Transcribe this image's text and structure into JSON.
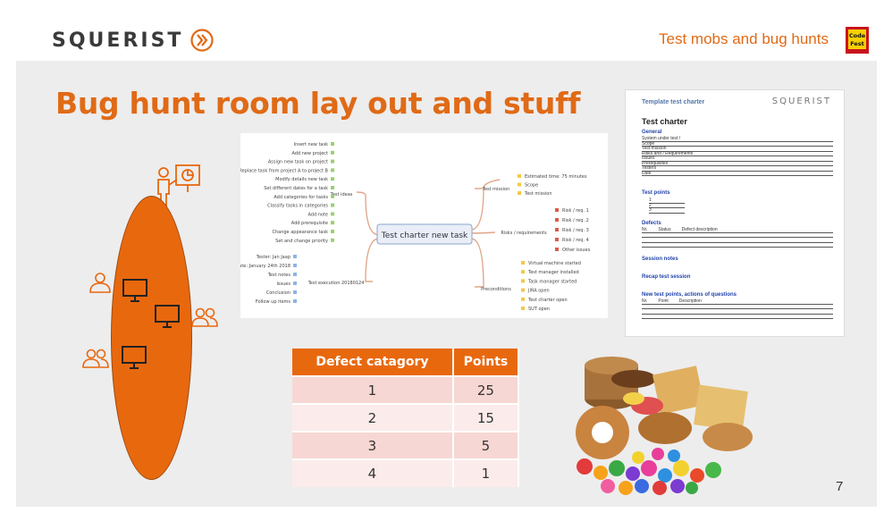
{
  "header": {
    "logo_text": "SQUERIST",
    "topic": "Test mobs and bug hunts",
    "codefest_logo": "Code Fest"
  },
  "slide": {
    "title": "Bug hunt room lay out and stuff",
    "page_number": "7"
  },
  "mindmap": {
    "center": "Test charter new task",
    "branches": {
      "ideas": "Test ideas",
      "mission": "Test mission",
      "risks": "Risks / requirements",
      "execution": "Test execution 20180124",
      "preconditions": "Preconditions"
    },
    "ideas_items": [
      "Insert new task",
      "Add new project",
      "Assign new task on project",
      "Replace task from project A to project B",
      "Modify details new task",
      "Set different dates for a task",
      "Add categories for tasks",
      "Classify tasks in categories",
      "Add note",
      "Add prerequisite",
      "Change appearance task",
      "Set and change priority"
    ],
    "mission_items": [
      "Estimated time: 75 minutes",
      "Scope",
      "Test mission"
    ],
    "risks_items": [
      "Risk / req. 1",
      "Risk / req. 2",
      "Risk / req. 3",
      "Risk / req. 4",
      "Other issues"
    ],
    "execution_items": [
      "Tester: Jan Jaap",
      "Date: January 24th 2018",
      "Test notes",
      "Issues",
      "Conclusion",
      "Follow up items"
    ],
    "precondition_items": [
      "Virtual machine started",
      "Test manager installed",
      "Task manager started",
      "JIRA open",
      "Test charter open",
      "SUT open"
    ]
  },
  "charter": {
    "header": "Template test charter",
    "logo": "SQUERIST",
    "title": "Test charter",
    "general_label": "General",
    "general_rows": [
      "System under test /",
      "Scope",
      "Test mission",
      "Risks and / Requirements",
      "Issues",
      "Prerequisites",
      "Testers",
      "Date"
    ],
    "test_points_label": "Test points",
    "test_points": [
      "1",
      "2",
      "3"
    ],
    "defects_label": "Defects",
    "defects_cols": [
      "Nr.",
      "Status",
      "Defect description"
    ],
    "session_notes_label": "Session notes",
    "recap_label": "Recap test session",
    "new_points_label": "New test points, actions of questions",
    "new_points_cols": [
      "Nr.",
      "Point",
      "Description"
    ]
  },
  "defect_table": {
    "headers": [
      "Defect catagory",
      "Points"
    ],
    "rows": [
      [
        "1",
        "25"
      ],
      [
        "2",
        "15"
      ],
      [
        "3",
        "5"
      ],
      [
        "4",
        "1"
      ]
    ]
  },
  "colors": {
    "accent": "#e8680e",
    "slide_bg": "#ededed",
    "row_odd": "#f7d7d3",
    "row_even": "#fbeceb"
  }
}
